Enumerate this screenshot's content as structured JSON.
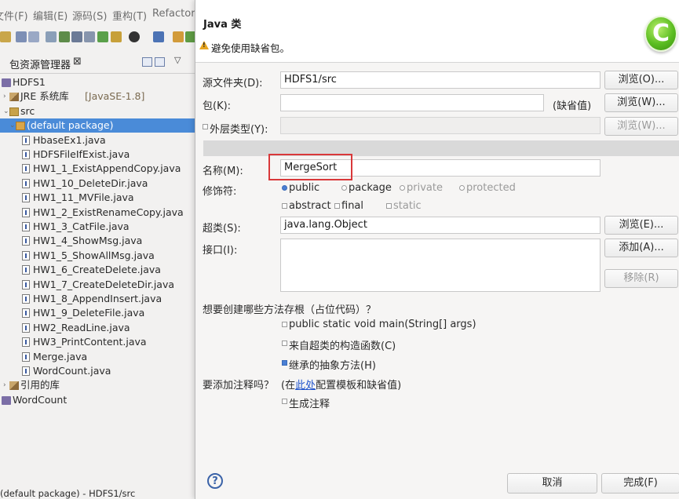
{
  "ide": {
    "menu": [
      "文件(F)",
      "编辑(E)",
      "源码(S)",
      "重构(T)",
      "Refactor"
    ],
    "view_tab": {
      "title": "包资源管理器",
      "close": "⊠"
    },
    "tree": [
      {
        "label": "HDFS1",
        "suffix": "",
        "type": "proj",
        "level": 0
      },
      {
        "label": "JRE 系统库 ",
        "suffix": "[JavaSE-1.8]",
        "type": "lib",
        "level": 1
      },
      {
        "label": "src",
        "suffix": "",
        "type": "src",
        "level": 1
      },
      {
        "label": "(default package)",
        "suffix": "",
        "type": "pkg",
        "level": 2,
        "selected": true
      },
      {
        "label": "HbaseEx1.java",
        "type": "java",
        "level": 3
      },
      {
        "label": "HDFSFileIfExist.java",
        "type": "java",
        "level": 3
      },
      {
        "label": "HW1_1_ExistAppendCopy.java",
        "type": "java",
        "level": 3
      },
      {
        "label": "HW1_10_DeleteDir.java",
        "type": "java",
        "level": 3
      },
      {
        "label": "HW1_11_MVFile.java",
        "type": "java",
        "level": 3
      },
      {
        "label": "HW1_2_ExistRenameCopy.java",
        "type": "java",
        "level": 3
      },
      {
        "label": "HW1_3_CatFile.java",
        "type": "java",
        "level": 3
      },
      {
        "label": "HW1_4_ShowMsg.java",
        "type": "java",
        "level": 3
      },
      {
        "label": "HW1_5_ShowAllMsg.java",
        "type": "java",
        "level": 3
      },
      {
        "label": "HW1_6_CreateDelete.java",
        "type": "java",
        "level": 3
      },
      {
        "label": "HW1_7_CreateDeleteDir.java",
        "type": "java",
        "level": 3
      },
      {
        "label": "HW1_8_AppendInsert.java",
        "type": "java",
        "level": 3
      },
      {
        "label": "HW1_9_DeleteFile.java",
        "type": "java",
        "level": 3
      },
      {
        "label": "HW2_ReadLine.java",
        "type": "java",
        "level": 3
      },
      {
        "label": "HW3_PrintContent.java",
        "type": "java",
        "level": 3
      },
      {
        "label": "Merge.java",
        "type": "java",
        "level": 3
      },
      {
        "label": "WordCount.java",
        "type": "java",
        "level": 3
      },
      {
        "label": "引用的库",
        "suffix": "",
        "type": "lib",
        "level": 1
      },
      {
        "label": "WordCount",
        "suffix": "",
        "type": "proj",
        "level": 0
      }
    ],
    "status": "(default package) - HDFS1/src"
  },
  "dialog": {
    "title": "Java 类",
    "warning": "避免使用缺省包。",
    "source_folder": {
      "label": "源文件夹(D):",
      "value": "HDFS1/src",
      "browse": "浏览(O)..."
    },
    "package": {
      "label": "包(K):",
      "value": "",
      "default_hint": "(缺省值)",
      "browse": "浏览(W)..."
    },
    "enclosing": {
      "label": "外层类型(Y):",
      "value": "",
      "browse": "浏览(W)..."
    },
    "name": {
      "label": "名称(M):",
      "value": "MergeSort"
    },
    "modifiers": {
      "label": "修饰符:",
      "access": [
        {
          "text": "public",
          "on": true,
          "disabled": false
        },
        {
          "text": "package",
          "on": false,
          "disabled": false
        },
        {
          "text": "private",
          "on": false,
          "disabled": true
        },
        {
          "text": "protected",
          "on": false,
          "disabled": true
        }
      ],
      "other": [
        {
          "text": "abstract",
          "on": false,
          "disabled": false
        },
        {
          "text": "final",
          "on": false,
          "disabled": false
        },
        {
          "text": "static",
          "on": false,
          "disabled": true
        }
      ]
    },
    "superclass": {
      "label": "超类(S):",
      "value": "java.lang.Object",
      "browse": "浏览(E)..."
    },
    "interfaces": {
      "label": "接口(I):",
      "add": "添加(A)...",
      "remove": "移除(R)"
    },
    "stubs": {
      "question": "想要创建哪些方法存根（占位代码）？",
      "items": [
        {
          "text": "public static void main(String[] args)",
          "on": false
        },
        {
          "text": "来自超类的构造函数(C)",
          "on": false
        },
        {
          "text": "继承的抽象方法(H)",
          "on": true
        }
      ]
    },
    "comments": {
      "question": "要添加注释吗？",
      "hint_prefix": "(在",
      "hint_link": "此处",
      "hint_suffix": "配置模板和缺省值)",
      "generate": "生成注释"
    },
    "buttons": {
      "help": "?",
      "cancel": "取消",
      "finish": "完成(F)"
    },
    "logo_letter": "C"
  }
}
